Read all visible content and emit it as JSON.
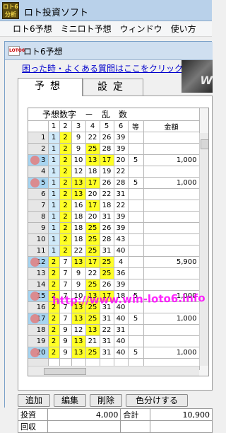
{
  "window": {
    "title": "ロト投資ソフト",
    "icon_text": "ロト6 分析"
  },
  "menu": [
    "ロト6予想",
    "ミニロト予想",
    "ウィンドウ",
    "使い方"
  ],
  "child": {
    "title": "ロト6予想",
    "icon_text": "LOTO6",
    "help_link": "困った時・よくある質問はここをクリック",
    "banner_text": "W"
  },
  "tabs": [
    "予想",
    "設定"
  ],
  "grid": {
    "caption": "予想数字　－　乱　数",
    "headers": [
      "1",
      "2",
      "3",
      "4",
      "5",
      "6",
      "等",
      "金額"
    ],
    "rows": [
      {
        "n": "1",
        "nums": [
          "1",
          "2",
          "9",
          "22",
          "26",
          "39"
        ],
        "hl": [
          false,
          true,
          false,
          false,
          false,
          false
        ],
        "grade": "",
        "amount": ""
      },
      {
        "n": "2",
        "nums": [
          "1",
          "2",
          "9",
          "25",
          "28",
          "39"
        ],
        "hl": [
          false,
          true,
          false,
          true,
          false,
          false
        ],
        "grade": "",
        "amount": ""
      },
      {
        "n": "3",
        "nums": [
          "1",
          "2",
          "10",
          "13",
          "17",
          "20"
        ],
        "hl": [
          false,
          true,
          false,
          true,
          true,
          false
        ],
        "grade": "5",
        "amount": "1,000"
      },
      {
        "n": "4",
        "nums": [
          "1",
          "2",
          "12",
          "18",
          "19",
          "22"
        ],
        "hl": [
          false,
          true,
          false,
          false,
          false,
          false
        ],
        "grade": "",
        "amount": ""
      },
      {
        "n": "5",
        "nums": [
          "1",
          "2",
          "13",
          "17",
          "26",
          "28"
        ],
        "hl": [
          false,
          true,
          true,
          true,
          false,
          false
        ],
        "grade": "5",
        "amount": "1,000"
      },
      {
        "n": "6",
        "nums": [
          "1",
          "2",
          "13",
          "20",
          "22",
          "31"
        ],
        "hl": [
          false,
          true,
          true,
          false,
          false,
          false
        ],
        "grade": "",
        "amount": ""
      },
      {
        "n": "7",
        "nums": [
          "1",
          "2",
          "16",
          "17",
          "18",
          "22"
        ],
        "hl": [
          false,
          true,
          false,
          true,
          false,
          false
        ],
        "grade": "",
        "amount": ""
      },
      {
        "n": "8",
        "nums": [
          "1",
          "2",
          "18",
          "20",
          "31",
          "39"
        ],
        "hl": [
          false,
          true,
          false,
          false,
          false,
          false
        ],
        "grade": "",
        "amount": ""
      },
      {
        "n": "9",
        "nums": [
          "1",
          "2",
          "18",
          "25",
          "26",
          "39"
        ],
        "hl": [
          false,
          true,
          false,
          true,
          false,
          false
        ],
        "grade": "",
        "amount": ""
      },
      {
        "n": "10",
        "nums": [
          "1",
          "2",
          "18",
          "25",
          "28",
          "43"
        ],
        "hl": [
          false,
          true,
          false,
          true,
          false,
          false
        ],
        "grade": "",
        "amount": ""
      },
      {
        "n": "11",
        "nums": [
          "1",
          "2",
          "22",
          "25",
          "31",
          "40"
        ],
        "hl": [
          false,
          true,
          false,
          true,
          false,
          false
        ],
        "grade": "",
        "amount": ""
      },
      {
        "n": "12",
        "nums": [
          "2",
          "7",
          "13",
          "17",
          "25",
          "4"
        ],
        "hl": [
          true,
          false,
          true,
          true,
          true,
          false
        ],
        "grade": "",
        "amount": "5,900"
      },
      {
        "n": "13",
        "nums": [
          "2",
          "7",
          "9",
          "22",
          "25",
          "36"
        ],
        "hl": [
          true,
          false,
          false,
          false,
          true,
          false
        ],
        "grade": "",
        "amount": ""
      },
      {
        "n": "14",
        "nums": [
          "2",
          "7",
          "9",
          "25",
          "26",
          "39"
        ],
        "hl": [
          true,
          false,
          false,
          true,
          false,
          false
        ],
        "grade": "",
        "amount": ""
      },
      {
        "n": "15",
        "nums": [
          "2",
          "7",
          "10",
          "13",
          "17",
          "18"
        ],
        "hl": [
          true,
          false,
          false,
          true,
          true,
          false
        ],
        "grade": "5",
        "amount": "1,000"
      },
      {
        "n": "16",
        "nums": [
          "2",
          "7",
          "13",
          "25",
          "31",
          "40"
        ],
        "hl": [
          true,
          false,
          true,
          true,
          false,
          false
        ],
        "grade": "",
        "amount": ""
      },
      {
        "n": "17",
        "nums": [
          "2",
          "7",
          "13",
          "25",
          "31",
          "40"
        ],
        "hl": [
          true,
          false,
          true,
          true,
          false,
          false
        ],
        "grade": "5",
        "amount": "1,000"
      },
      {
        "n": "18",
        "nums": [
          "2",
          "9",
          "12",
          "13",
          "22",
          "31"
        ],
        "hl": [
          true,
          false,
          false,
          true,
          false,
          false
        ],
        "grade": "",
        "amount": ""
      },
      {
        "n": "19",
        "nums": [
          "2",
          "9",
          "13",
          "21",
          "31",
          "40"
        ],
        "hl": [
          true,
          false,
          true,
          false,
          false,
          false
        ],
        "grade": "",
        "amount": ""
      },
      {
        "n": "20",
        "nums": [
          "2",
          "9",
          "13",
          "25",
          "31",
          "40"
        ],
        "hl": [
          true,
          false,
          true,
          true,
          false,
          false
        ],
        "grade": "5",
        "amount": "1,000"
      }
    ],
    "marked_rows": [
      "3",
      "5",
      "12",
      "15",
      "17",
      "20"
    ],
    "highlight_color": "#ffff26",
    "marker_color": "#e37e7e"
  },
  "watermark": "http://www.win-loto6.info",
  "buttons": [
    "追加",
    "編集",
    "削除",
    "色分けする"
  ],
  "summary": {
    "invest_label": "投資",
    "invest_value": "4,000",
    "total_label": "合計",
    "total_value": "10,900",
    "row3_label": "回収",
    "row3_value": ""
  }
}
